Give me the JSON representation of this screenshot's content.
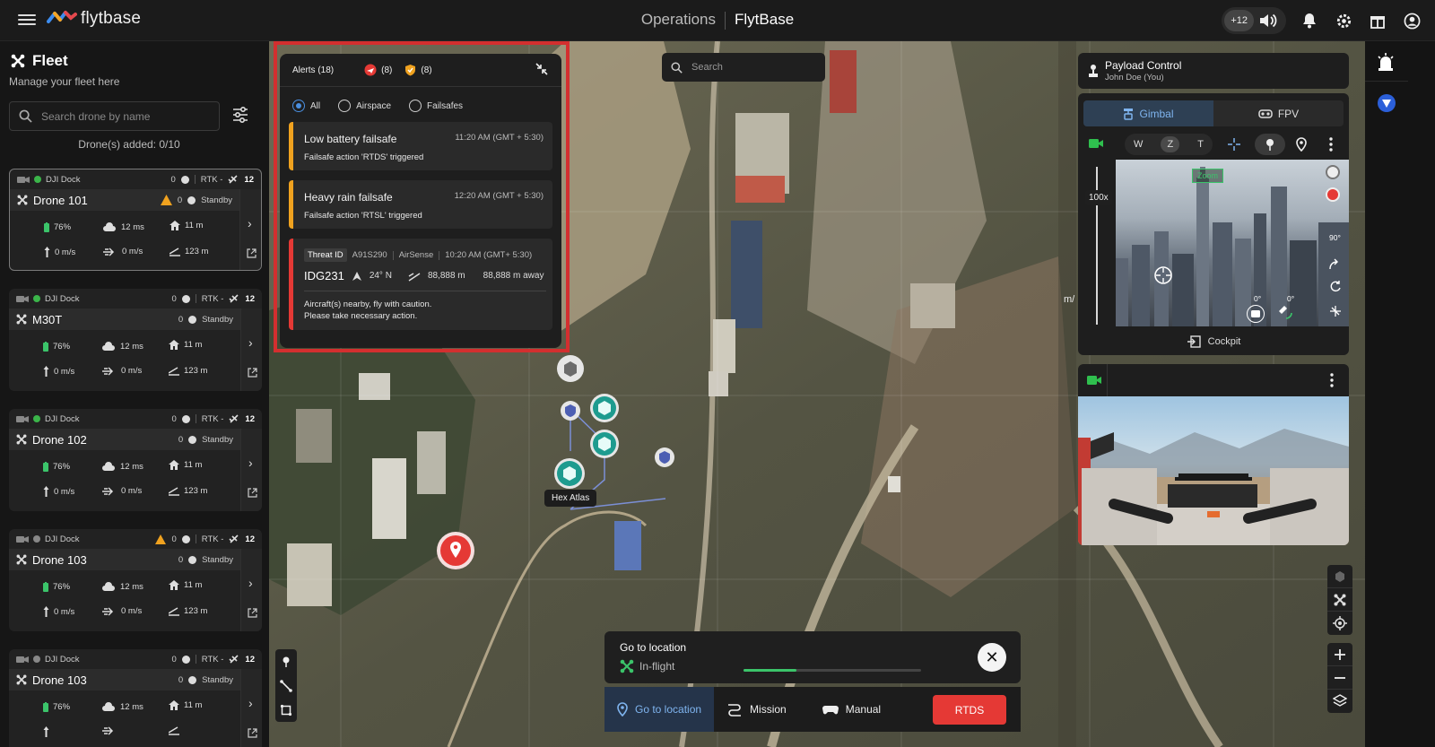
{
  "header": {
    "logo_text": "flytbase",
    "section": "Operations",
    "org": "FlytBase",
    "notification_count": "+12",
    "icons": [
      "menu-icon",
      "volume-icon",
      "bell-icon",
      "gear-icon",
      "gift-icon",
      "user-icon"
    ]
  },
  "fleet": {
    "title": "Fleet",
    "subtitle": "Manage your fleet here",
    "search_placeholder": "Search drone by name",
    "drones_added": "Drone(s) added: 0/10",
    "cards": [
      {
        "dock": "DJI Dock",
        "dock_count": "0",
        "rtk": "RTK -",
        "sats": "12",
        "name": "Drone 101",
        "alerts": "0",
        "status": "Standby",
        "battery": "76%",
        "latency": "12 ms",
        "height": "11 m",
        "vspeed": "0 m/s",
        "hspeed": "0 m/s",
        "distance": "123 m"
      },
      {
        "dock": "DJI Dock",
        "dock_count": "0",
        "rtk": "RTK -",
        "sats": "12",
        "name": "M30T",
        "alerts": "0",
        "status": "Standby",
        "battery": "76%",
        "latency": "12 ms",
        "height": "11 m",
        "vspeed": "0 m/s",
        "hspeed": "0 m/s",
        "distance": "123 m"
      },
      {
        "dock": "DJI Dock",
        "dock_count": "0",
        "rtk": "RTK -",
        "sats": "12",
        "name": "Drone 102",
        "alerts": "0",
        "status": "Standby",
        "battery": "76%",
        "latency": "12 ms",
        "height": "11 m",
        "vspeed": "0 m/s",
        "hspeed": "0 m/s",
        "distance": "123 m"
      },
      {
        "dock": "DJI Dock",
        "dock_count": "0",
        "rtk": "RTK -",
        "sats": "12",
        "name": "Drone 103",
        "alerts": "0",
        "status": "Standby",
        "battery": "76%",
        "latency": "12 ms",
        "height": "11 m",
        "vspeed": "0 m/s",
        "hspeed": "0 m/s",
        "distance": "123 m"
      },
      {
        "dock": "DJI Dock",
        "dock_count": "0",
        "rtk": "RTK -",
        "sats": "12",
        "name": "Drone 103",
        "alerts": "0",
        "status": "Standby",
        "battery": "76%",
        "latency": "12 ms",
        "height": "11 m",
        "vspeed": "",
        "hspeed": "",
        "distance": ""
      }
    ]
  },
  "alerts": {
    "title": "Alerts (18)",
    "airspace_count": "(8)",
    "failsafe_count": "(8)",
    "filters": [
      "All",
      "Airspace",
      "Failsafes"
    ],
    "selected_filter": "All",
    "items": [
      {
        "title": "Low battery failsafe",
        "time": "11:20 AM (GMT + 5:30)",
        "detail": "Failsafe action 'RTDS' triggered"
      },
      {
        "title": "Heavy rain failsafe",
        "time": "12:20 AM (GMT + 5:30)",
        "detail": "Failsafe action 'RTSL' triggered"
      }
    ],
    "threat": {
      "label": "Threat ID",
      "id": "A91S290",
      "source": "AirSense",
      "time": "10:20 AM (GMT+ 5:30)",
      "callsign": "IDG231",
      "heading": "24° N",
      "altitude": "88,888 m",
      "distance": "88,888 m away",
      "message_1": "Aircraft(s) nearby, fly with caution.",
      "message_2": "Please take necessary action."
    }
  },
  "map": {
    "search_placeholder": "Search",
    "hex_label": "Hex Atlas",
    "speed_unit": "m/"
  },
  "payload": {
    "title": "Payload Control",
    "user": "John Doe (You)",
    "tabs": [
      "Gimbal",
      "FPV"
    ],
    "active_tab": "Gimbal",
    "zoom_modes": [
      "W",
      "Z",
      "T"
    ],
    "active_zoom": "Z",
    "zoom_level": "100x",
    "zoom_badge": "Zoom",
    "pitch_marks": [
      "90°",
      "0°",
      "0°"
    ],
    "gimbal_angle": "0°",
    "gimbal_angle_2": "0°",
    "cockpit_label": "Cockpit"
  },
  "goto": {
    "title": "Go to location",
    "status": "In-flight",
    "progress": 0.3
  },
  "modes": {
    "items": [
      "Go to location",
      "Mission",
      "Manual"
    ],
    "active": "Go to location",
    "rtds": "RTDS"
  },
  "colors": {
    "accent_blue": "#4a8fe0",
    "alert_red": "#e53935",
    "warning_orange": "#f0a21f",
    "ok_green": "#3bb54a"
  }
}
